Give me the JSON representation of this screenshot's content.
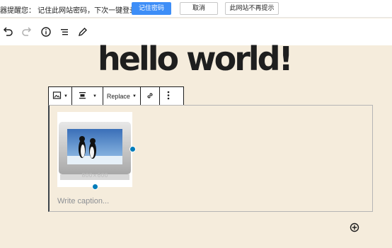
{
  "password_bar": {
    "message": "器提醒您： 记住此网站密码，下次一键登录！",
    "remember_label": "记住密码",
    "cancel_label": "取消",
    "never_label": "此网站不再提示"
  },
  "toolbar": {
    "icons": [
      "undo-icon",
      "redo-icon",
      "info-icon",
      "list-view-icon",
      "edit-icon"
    ]
  },
  "post": {
    "title": "hello world!"
  },
  "block_toolbar": {
    "replace_label": "Replace"
  },
  "image_block": {
    "caption_placeholder": "Write caption...",
    "image_watermark": "800×600"
  },
  "colors": {
    "accent": "#007cba",
    "primary_button": "#3e8ef7",
    "canvas_background": "#f5ecdc"
  }
}
